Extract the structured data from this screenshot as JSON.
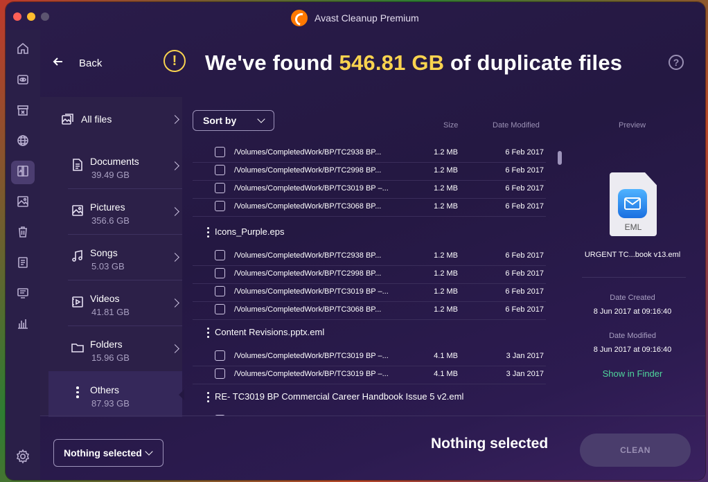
{
  "window": {
    "title": "Avast Cleanup Premium"
  },
  "header": {
    "back_label": "Back",
    "headline_pre": "We've found ",
    "headline_amount": "546.81 GB",
    "headline_post": " of duplicate files",
    "alert_glyph": "!",
    "help_glyph": "?"
  },
  "sidebar": {
    "all_files_label": "All files",
    "categories": [
      {
        "name": "Documents",
        "size": "39.49 GB",
        "icon": "document-icon"
      },
      {
        "name": "Pictures",
        "size": "356.6 GB",
        "icon": "picture-icon"
      },
      {
        "name": "Songs",
        "size": "5.03 GB",
        "icon": "music-note-icon"
      },
      {
        "name": "Videos",
        "size": "41.81 GB",
        "icon": "video-icon"
      },
      {
        "name": "Folders",
        "size": "15.96 GB",
        "icon": "folder-icon"
      },
      {
        "name": "Others",
        "size": "87.93 GB",
        "icon": "more-dots-icon"
      }
    ]
  },
  "list": {
    "sort_label": "Sort by",
    "col_size": "Size",
    "col_date": "Date Modified",
    "rows": [
      {
        "path": "/Volumes/CompletedWork/BP/TC2938 BP...",
        "size": "1.2 MB",
        "date": "6 Feb 2017"
      },
      {
        "path": "/Volumes/CompletedWork/BP/TC2998 BP...",
        "size": "1.2 MB",
        "date": "6 Feb 2017"
      },
      {
        "path": "/Volumes/CompletedWork/BP/TC3019 BP –...",
        "size": "1.2 MB",
        "date": "6 Feb 2017"
      },
      {
        "path": "/Volumes/CompletedWork/BP/TC3068 BP...",
        "size": "1.2 MB",
        "date": "6 Feb 2017"
      },
      {
        "path": "/Volumes/CompletedWork/BP/TC2938 BP...",
        "size": "1.2 MB",
        "date": "6 Feb 2017"
      },
      {
        "path": "/Volumes/CompletedWork/BP/TC2998 BP...",
        "size": "1.2 MB",
        "date": "6 Feb 2017"
      },
      {
        "path": "/Volumes/CompletedWork/BP/TC3019 BP –...",
        "size": "1.2 MB",
        "date": "6 Feb 2017"
      },
      {
        "path": "/Volumes/CompletedWork/BP/TC3068 BP...",
        "size": "1.2 MB",
        "date": "6 Feb 2017"
      },
      {
        "path": "/Volumes/CompletedWork/BP/TC3019 BP –...",
        "size": "4.1 MB",
        "date": "3 Jan 2017"
      },
      {
        "path": "/Volumes/CompletedWork/BP/TC3019 BP –...",
        "size": "4.1 MB",
        "date": "3 Jan 2017"
      }
    ],
    "groups": [
      {
        "name": "Icons_Purple.eps"
      },
      {
        "name": "Content Revisions.pptx.eml"
      },
      {
        "name": "RE- TC3019 BP Commercial Career Handbook Issue 5 v2.eml"
      }
    ]
  },
  "preview": {
    "header": "Preview",
    "file_ext": "EML",
    "file_name": "URGENT TC...book v13.eml",
    "created_label": "Date Created",
    "created_value": "8 Jun 2017 at 09:16:40",
    "modified_label": "Date Modified",
    "modified_value": "8 Jun 2017 at 09:16:40",
    "finder_link": "Show in Finder"
  },
  "footer": {
    "selection_dropdown": "Nothing selected",
    "status": "Nothing selected",
    "clean_label": "CLEAN"
  },
  "colors": {
    "accent_yellow": "#f9d34f",
    "link_green": "#4fd69c",
    "window_bg": "#241842"
  }
}
